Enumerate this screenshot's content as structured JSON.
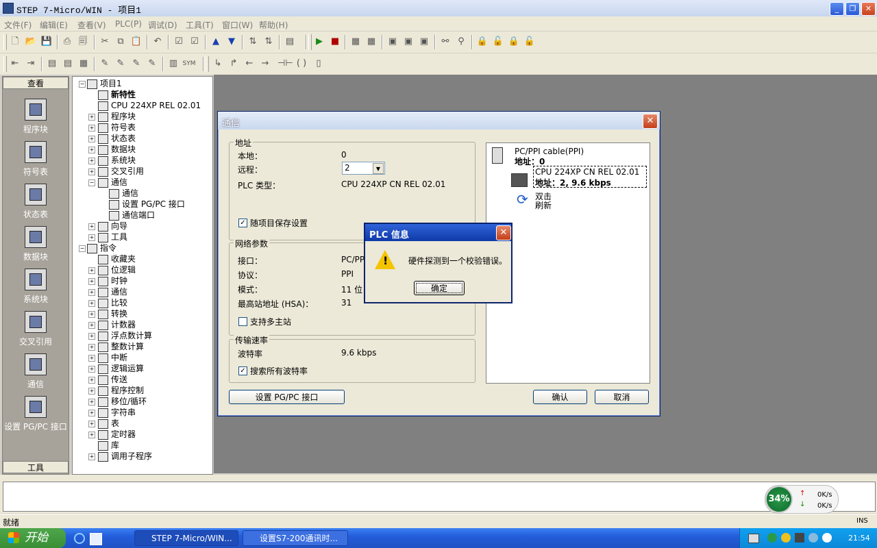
{
  "window": {
    "title": "STEP 7-Micro/WIN - 项目1"
  },
  "menu": [
    "文件(F)",
    "编辑(E)",
    "查看(V)",
    "PLC(P)",
    "调试(D)",
    "工具(T)",
    "窗口(W)",
    "帮助(H)"
  ],
  "nav": {
    "header": "查看",
    "footer": "工具",
    "items": [
      "程序块",
      "符号表",
      "状态表",
      "数据块",
      "系统块",
      "交叉引用",
      "通信",
      "设置 PG/PC 接口"
    ]
  },
  "tree": [
    {
      "label": "项目1",
      "indent": 0,
      "exp": "-"
    },
    {
      "label": "新特性",
      "indent": 1,
      "exp": "",
      "bold": true
    },
    {
      "label": "CPU 224XP REL 02.01",
      "indent": 1,
      "exp": ""
    },
    {
      "label": "程序块",
      "indent": 1,
      "exp": "+"
    },
    {
      "label": "符号表",
      "indent": 1,
      "exp": "+"
    },
    {
      "label": "状态表",
      "indent": 1,
      "exp": "+"
    },
    {
      "label": "数据块",
      "indent": 1,
      "exp": "+"
    },
    {
      "label": "系统块",
      "indent": 1,
      "exp": "+"
    },
    {
      "label": "交叉引用",
      "indent": 1,
      "exp": "+"
    },
    {
      "label": "通信",
      "indent": 1,
      "exp": "-"
    },
    {
      "label": "通信",
      "indent": 2,
      "exp": ""
    },
    {
      "label": "设置 PG/PC 接口",
      "indent": 2,
      "exp": ""
    },
    {
      "label": "通信端口",
      "indent": 2,
      "exp": ""
    },
    {
      "label": "向导",
      "indent": 1,
      "exp": "+"
    },
    {
      "label": "工具",
      "indent": 1,
      "exp": "+"
    },
    {
      "label": "指令",
      "indent": 0,
      "exp": "-"
    },
    {
      "label": "收藏夹",
      "indent": 1,
      "exp": ""
    },
    {
      "label": "位逻辑",
      "indent": 1,
      "exp": "+"
    },
    {
      "label": "时钟",
      "indent": 1,
      "exp": "+"
    },
    {
      "label": "通信",
      "indent": 1,
      "exp": "+"
    },
    {
      "label": "比较",
      "indent": 1,
      "exp": "+"
    },
    {
      "label": "转换",
      "indent": 1,
      "exp": "+"
    },
    {
      "label": "计数器",
      "indent": 1,
      "exp": "+"
    },
    {
      "label": "浮点数计算",
      "indent": 1,
      "exp": "+"
    },
    {
      "label": "整数计算",
      "indent": 1,
      "exp": "+"
    },
    {
      "label": "中断",
      "indent": 1,
      "exp": "+"
    },
    {
      "label": "逻辑运算",
      "indent": 1,
      "exp": "+"
    },
    {
      "label": "传送",
      "indent": 1,
      "exp": "+"
    },
    {
      "label": "程序控制",
      "indent": 1,
      "exp": "+"
    },
    {
      "label": "移位/循环",
      "indent": 1,
      "exp": "+"
    },
    {
      "label": "字符串",
      "indent": 1,
      "exp": "+"
    },
    {
      "label": "表",
      "indent": 1,
      "exp": "+"
    },
    {
      "label": "定时器",
      "indent": 1,
      "exp": "+"
    },
    {
      "label": "库",
      "indent": 1,
      "exp": ""
    },
    {
      "label": "调用子程序",
      "indent": 1,
      "exp": "+"
    }
  ],
  "comm_dialog": {
    "title": "通信",
    "address_group": "地址",
    "local_label": "本地：",
    "local_value": "0",
    "remote_label": "远程：",
    "remote_value": "2",
    "plc_type_label": "PLC 类型：",
    "plc_type_value": "CPU 224XP CN REL 02.01",
    "save_with_project": "随项目保存设置",
    "net_group": "网络参数",
    "interface_label": "接口：",
    "interface_value": "PC/PPI",
    "protocol_label": "协议：",
    "protocol_value": "PPI",
    "mode_label": "模式：",
    "mode_value": "11 位",
    "hsa_label": "最高站地址 (HSA)：",
    "hsa_value": "31",
    "multi_master": "支持多主站",
    "rate_group": "传输速率",
    "baud_label": "波特率",
    "baud_value": "9.6 kbps",
    "search_all": "搜索所有波特率",
    "setup_button": "设置 PG/PC 接口",
    "ok_button": "确认",
    "cancel_button": "取消",
    "net": {
      "cable": "PC/PPI cable(PPI)",
      "cable_addr": "地址：0",
      "cpu": "CPU 224XP CN REL 02.01",
      "cpu_addr": "地址：2, 9.6 kbps",
      "refresh_1": "双击",
      "refresh_2": "刷新"
    }
  },
  "info_dialog": {
    "title": "PLC 信息",
    "message": "硬件探测到一个校验错误。",
    "ok": "确定"
  },
  "status": {
    "text": "就绪",
    "ins": "INS"
  },
  "netwidget": {
    "percent": "34%",
    "up": "0K/s",
    "down": "0K/s"
  },
  "taskbar": {
    "start": "开始",
    "tasks": [
      "STEP 7-Micro/WIN...",
      "设置S7-200通讯时..."
    ],
    "clock": "21:54"
  },
  "colors": {
    "workspace": "#808080",
    "taskbar": "#245edb",
    "title_active": "#0f3aa8"
  }
}
